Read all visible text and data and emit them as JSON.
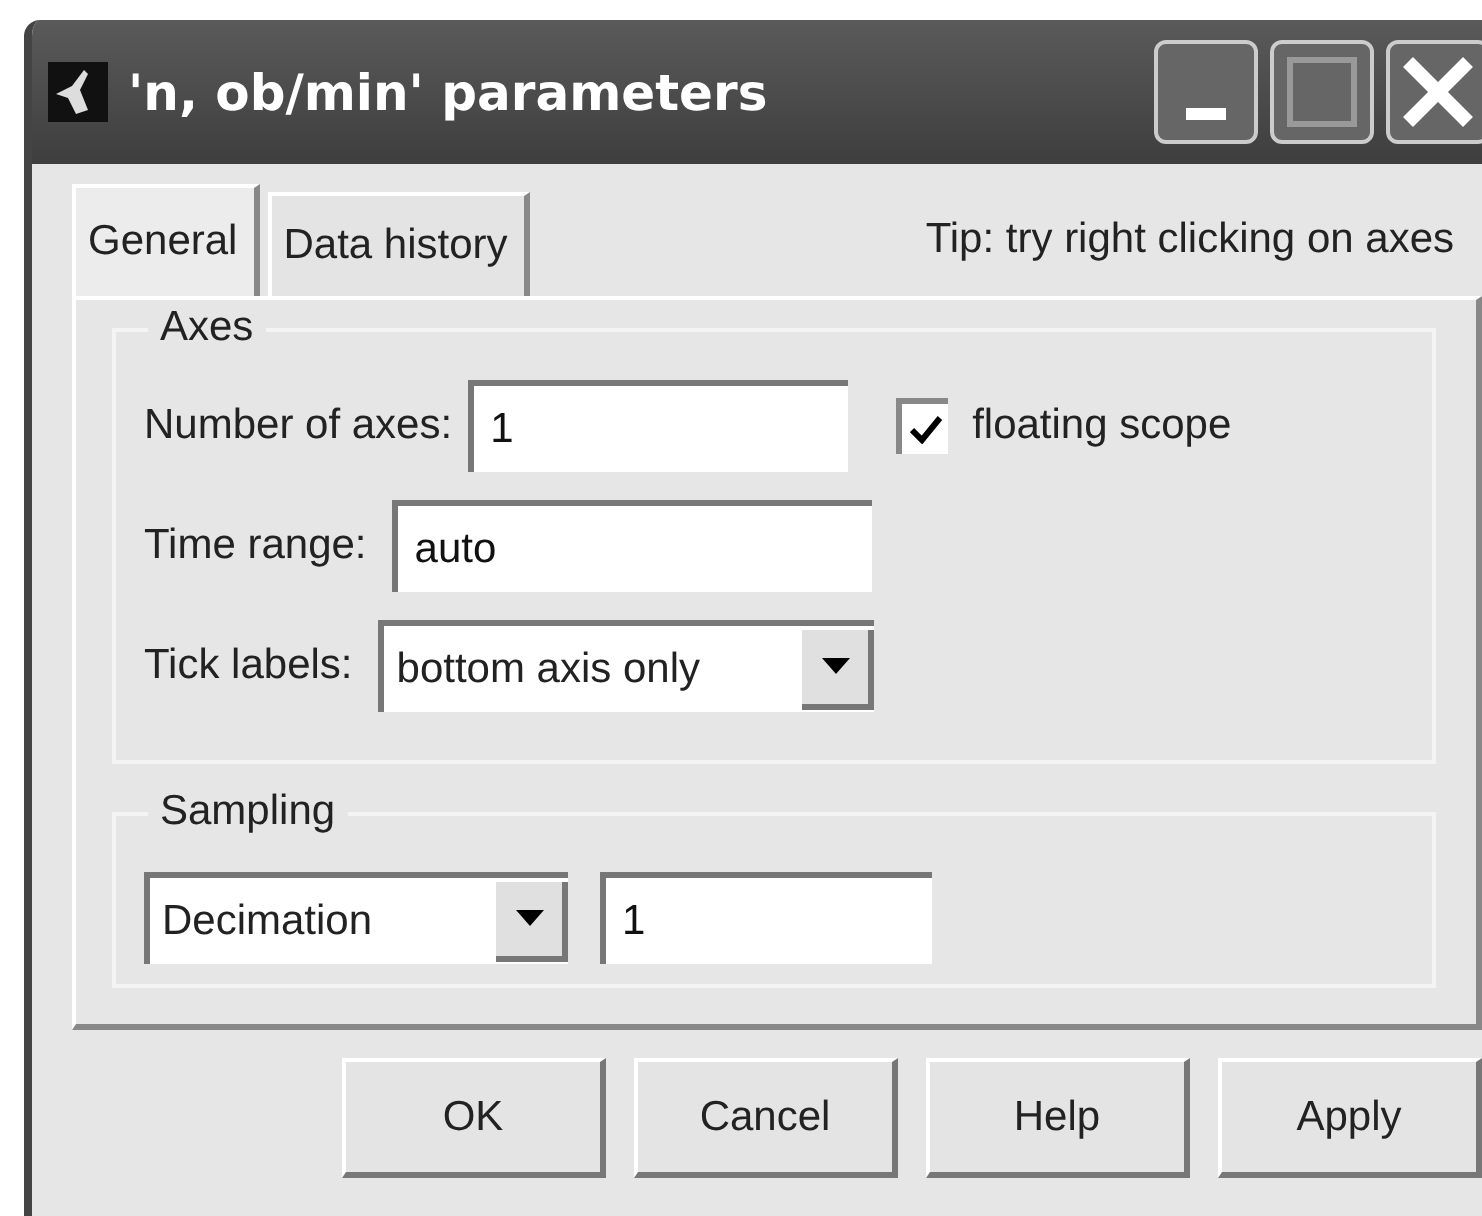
{
  "window": {
    "title": "'n, ob/min' parameters"
  },
  "tabs": [
    {
      "label": "General",
      "selected": true
    },
    {
      "label": "Data history",
      "selected": false
    }
  ],
  "tip": "Tip: try right clicking on axes",
  "axes": {
    "title": "Axes",
    "rows": [
      {
        "kind": "text",
        "label": "Number of axes:",
        "value": "1"
      },
      {
        "kind": "text",
        "label": "Time range:",
        "value": "auto"
      },
      {
        "kind": "dropdown",
        "label": "Tick labels:",
        "value": "bottom axis only"
      }
    ],
    "floating_scope": {
      "label": "floating scope",
      "checked": true
    }
  },
  "sampling": {
    "title": "Sampling",
    "mode": "Decimation",
    "value": "1"
  },
  "buttons": [
    "OK",
    "Cancel",
    "Help",
    "Apply"
  ]
}
